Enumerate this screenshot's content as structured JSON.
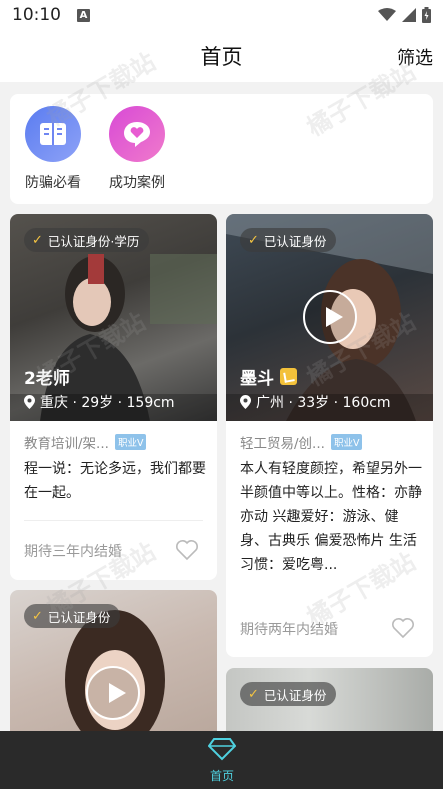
{
  "status_bar": {
    "time": "10:10",
    "notification_icon": "A"
  },
  "header": {
    "title": "首页",
    "filter_label": "筛选"
  },
  "quick_actions": [
    {
      "label": "防骗必看",
      "icon": "book-icon",
      "color": "#6f86f2"
    },
    {
      "label": "成功案例",
      "icon": "heart-chat-icon",
      "color": "#e85bd2"
    }
  ],
  "cards": [
    {
      "verify": "已认证身份·学历",
      "name": "2老师",
      "location": "重庆 · 29岁 · 159cm",
      "job": "教育培训/架...",
      "job_tag": "职业V",
      "intro": "程一说：无论多远，我们都要在一起。",
      "expect": "期待三年内结婚"
    },
    {
      "verify": "已认证身份",
      "name": "墨斗",
      "location": "广州 · 33岁 · 160cm",
      "job": "轻工贸易/创...",
      "job_tag": "职业V",
      "intro": "本人有轻度颜控，希望另外一半颜值中等以上。性格：亦静亦动 兴趣爱好：游泳、健身、古典乐 偏爱恐怖片 生活习惯：爱吃粤...",
      "expect": "期待两年内结婚"
    },
    {
      "verify": "已认证身份"
    },
    {
      "verify": "已认证身份"
    }
  ],
  "watermark": "橘子下载站",
  "bottom_nav": {
    "home_label": "首页",
    "active_color": "#4fd1e0"
  }
}
